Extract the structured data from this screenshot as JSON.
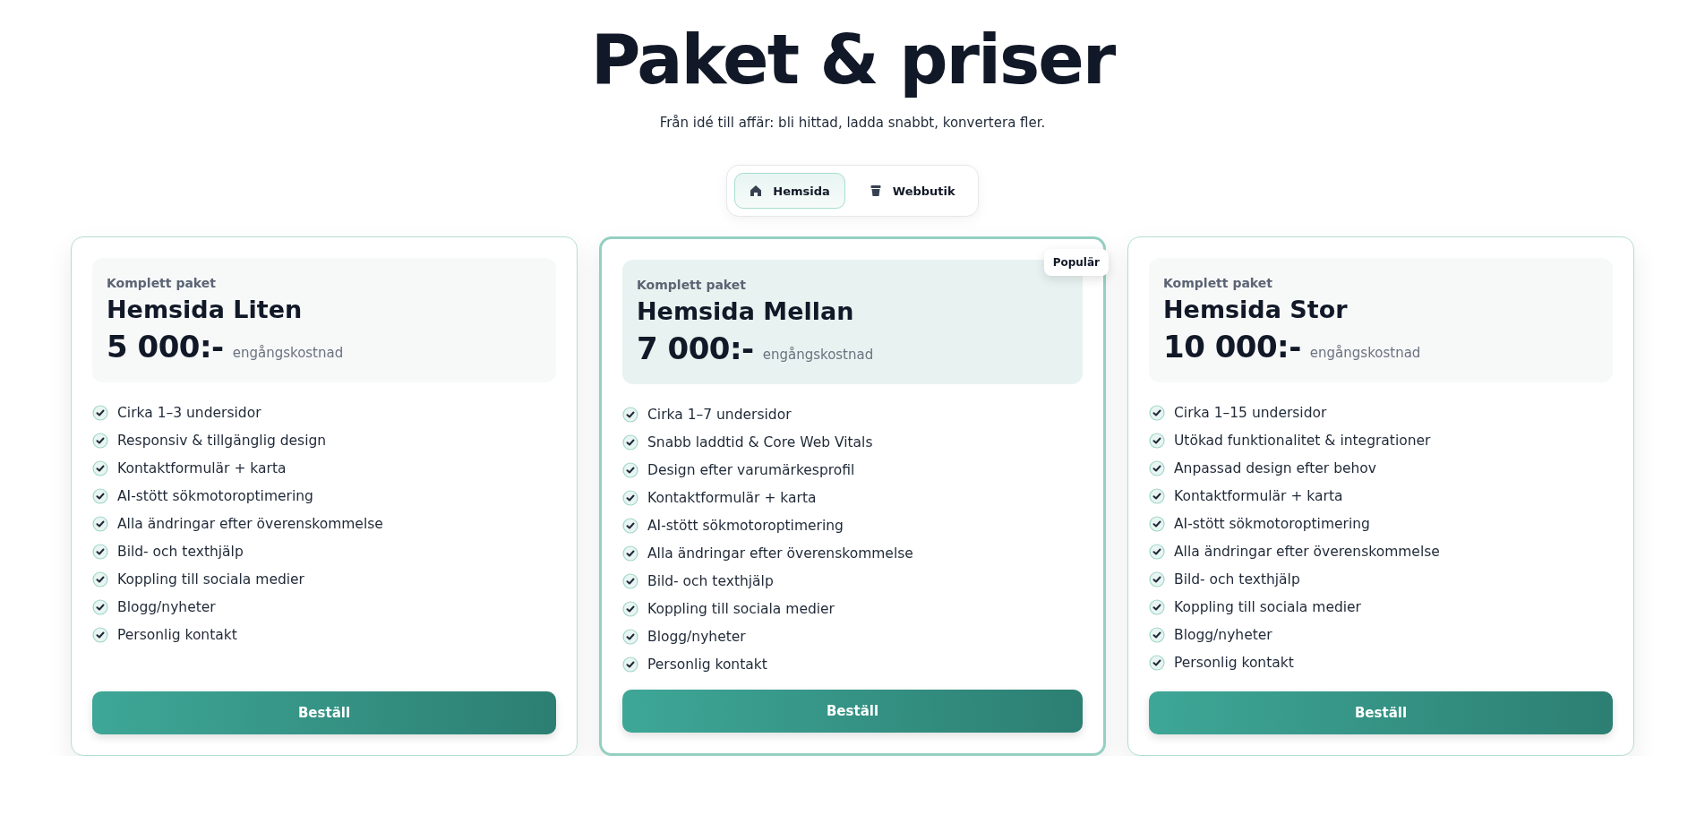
{
  "title": "Paket & priser",
  "subtitle": "Från idé till affär: bli hittad, ladda snabbt, konvertera fler.",
  "tabs": [
    {
      "label": "Hemsida",
      "kind": "house",
      "selected": true
    },
    {
      "label": "Webbutik",
      "kind": "bin",
      "selected": false
    }
  ],
  "plans": [
    {
      "eyebrow": "Komplett paket",
      "name": "Hemsida Liten",
      "price": "5 000:-",
      "price_note": "engångskostnad",
      "highlighted": false,
      "features": [
        "Cirka 1–3 undersidor",
        "Responsiv & tillgänglig design",
        "Kontaktformulär + karta",
        "AI-stött sökmotoroptimering",
        "Alla ändringar efter överenskommelse",
        "Bild- och texthjälp",
        "Koppling till sociala medier",
        "Blogg/nyheter",
        "Personlig kontakt"
      ],
      "button": "Beställ"
    },
    {
      "eyebrow": "Komplett paket",
      "name": "Hemsida Mellan",
      "price": "7 000:-",
      "price_note": "engångskostnad",
      "highlighted": true,
      "badge": "Populär",
      "features": [
        "Cirka 1–7 undersidor",
        "Snabb laddtid & Core Web Vitals",
        "Design efter varumärkesprofil",
        "Kontaktformulär + karta",
        "AI-stött sökmotoroptimering",
        "Alla ändringar efter överenskommelse",
        "Bild- och texthjälp",
        "Koppling till sociala medier",
        "Blogg/nyheter",
        "Personlig kontakt"
      ],
      "button": "Beställ"
    },
    {
      "eyebrow": "Komplett paket",
      "name": "Hemsida Stor",
      "price": "10 000:-",
      "price_note": "engångskostnad",
      "highlighted": false,
      "features": [
        "Cirka 1–15 undersidor",
        "Utökad funktionalitet & integrationer",
        "Anpassad design efter behov",
        "Kontaktformulär + karta",
        "AI-stött sökmotoroptimering",
        "Alla ändringar efter överenskommelse",
        "Bild- och texthjälp",
        "Koppling till sociala medier",
        "Blogg/nyheter",
        "Personlig kontakt"
      ],
      "button": "Beställ"
    }
  ]
}
